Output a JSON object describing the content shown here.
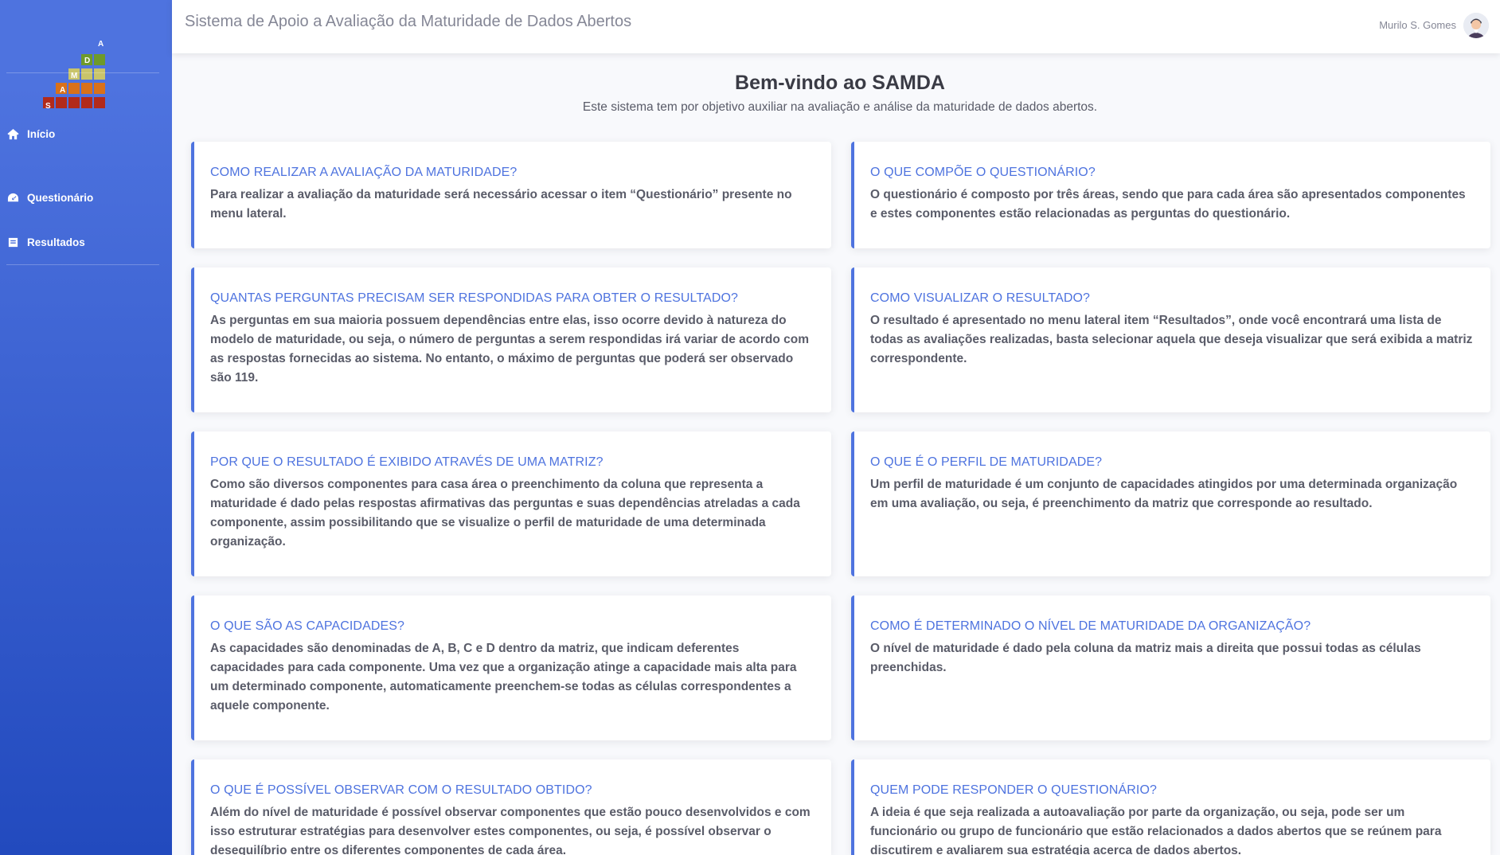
{
  "app": {
    "title": "Sistema de Apoio a Avaliação da Maturidade de Dados Abertos",
    "user_name": "Murilo S. Gomes"
  },
  "brand": {
    "letters": [
      "S",
      "A",
      "M",
      "D",
      "A"
    ]
  },
  "sidebar": {
    "items": [
      {
        "label": "Início",
        "icon": "home-icon"
      },
      {
        "label": "Questionário",
        "icon": "tachometer-icon"
      },
      {
        "label": "Resultados",
        "icon": "file-icon"
      }
    ]
  },
  "welcome": {
    "title": "Bem-vindo ao SAMDA",
    "subtitle": "Este sistema tem por objetivo auxiliar na avaliação e análise da maturidade de dados abertos."
  },
  "cards": [
    {
      "title": "COMO REALIZAR A AVALIAÇÃO DA MATURIDADE?",
      "text": "Para realizar a avaliação da maturidade será necessário acessar o item “Questionário” presente no menu lateral."
    },
    {
      "title": "O QUE COMPÕE O QUESTIONÁRIO?",
      "text": "O questionário é composto por três áreas, sendo que para cada área são apresentados componentes e estes componentes estão relacionadas as perguntas do questionário."
    },
    {
      "title": "QUANTAS PERGUNTAS PRECISAM SER RESPONDIDAS PARA OBTER O RESULTADO?",
      "text": "As perguntas em sua maioria possuem dependências entre elas, isso ocorre devido à natureza do modelo de maturidade, ou seja, o número de perguntas a serem respondidas irá variar de acordo com as respostas fornecidas ao sistema. No entanto, o máximo de perguntas que poderá ser observado são 119."
    },
    {
      "title": "COMO VISUALIZAR O RESULTADO?",
      "text": "O resultado é apresentado no menu lateral item “Resultados”, onde você encontrará uma lista de todas as avaliações realizadas, basta selecionar aquela que deseja visualizar que será exibida a matriz correspondente."
    },
    {
      "title": "POR QUE O RESULTADO É EXIBIDO ATRAVÉS DE UMA MATRIZ?",
      "text": "Como são diversos componentes para casa área o preenchimento da coluna que representa a maturidade é dado pelas respostas afirmativas das perguntas e suas dependências atreladas a cada componente, assim possibilitando que se visualize o perfil de maturidade de uma determinada organização."
    },
    {
      "title": "O QUE É O PERFIL DE MATURIDADE?",
      "text": "Um perfil de maturidade é um conjunto de capacidades atingidos por uma determinada organização em uma avaliação, ou seja, é preenchimento da matriz que corresponde ao resultado."
    },
    {
      "title": "O QUE SÃO AS CAPACIDADES?",
      "text": "As capacidades são denominadas de A, B, C e D dentro da matriz, que indicam deferentes capacidades para cada componente. Uma vez que a organização atinge a capacidade mais alta para um determinado componente, automaticamente preenchem-se todas as células correspondentes a aquele componente."
    },
    {
      "title": "COMO É DETERMINADO O NÍVEL DE MATURIDADE DA ORGANIZAÇÃO?",
      "text": "O nível de maturidade é dado pela coluna da matriz mais a direita que possui todas as células preenchidas."
    },
    {
      "title": "O QUE É POSSÍVEL OBSERVAR COM O RESULTADO OBTIDO?",
      "text": "Além do nível de maturidade é possível observar componentes que estão pouco desenvolvidos e com isso estruturar estratégias para desenvolver estes componentes, ou seja, é possível observar o desequilíbrio entre os diferentes componentes de cada área."
    },
    {
      "title": "QUEM PODE RESPONDER O QUESTIONÁRIO?",
      "text": "A ideia é que seja realizada a autoavaliação por parte da organização, ou seja, pode ser um funcionário ou grupo de funcionário que estão relacionados a dados abertos que se reúnem para discutirem e avaliarem sua estratégia acerca de dados abertos."
    }
  ]
}
